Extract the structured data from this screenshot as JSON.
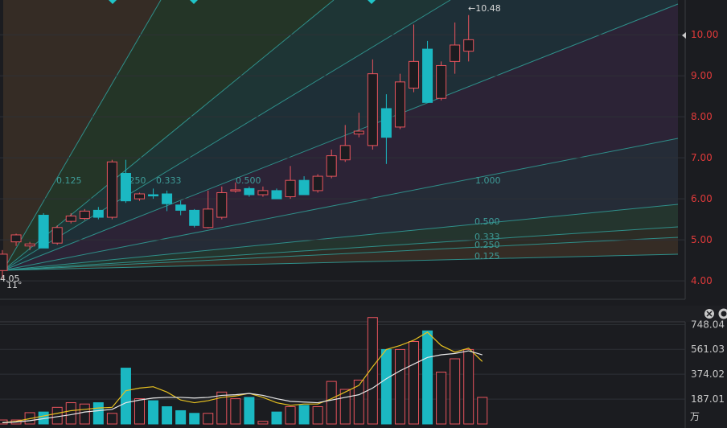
{
  "chart_data": [
    {
      "type": "candlestick",
      "title": "",
      "y_axis": {
        "ticks": [
          "10.00",
          "9.00",
          "8.00",
          "7.00",
          "6.00",
          "5.00",
          "4.00"
        ],
        "ylim": [
          3.55,
          10.75
        ]
      },
      "high_label": "10.48",
      "low_label": "4.05",
      "angle_label": "11°",
      "gann_fan_levels_upper": [
        "0.125",
        "0.250",
        "0.333",
        "0.500",
        "1.000"
      ],
      "gann_fan_levels_lower": [
        "0.500",
        "0.333",
        "0.250",
        "0.125"
      ],
      "candles": [
        {
          "o": 4.25,
          "h": 4.75,
          "l": 4.05,
          "c": 4.65
        },
        {
          "o": 4.95,
          "h": 5.15,
          "l": 4.85,
          "c": 5.12
        },
        {
          "o": 4.85,
          "h": 4.95,
          "l": 4.75,
          "c": 4.9
        },
        {
          "o": 5.6,
          "h": 5.65,
          "l": 4.8,
          "c": 4.8
        },
        {
          "o": 4.92,
          "h": 5.35,
          "l": 4.88,
          "c": 5.3
        },
        {
          "o": 5.45,
          "h": 5.65,
          "l": 5.4,
          "c": 5.58
        },
        {
          "o": 5.52,
          "h": 5.75,
          "l": 5.48,
          "c": 5.7
        },
        {
          "o": 5.72,
          "h": 5.8,
          "l": 5.5,
          "c": 5.55
        },
        {
          "o": 5.55,
          "h": 6.95,
          "l": 5.5,
          "c": 6.9
        },
        {
          "o": 6.62,
          "h": 6.95,
          "l": 5.9,
          "c": 5.95
        },
        {
          "o": 6.0,
          "h": 6.15,
          "l": 5.95,
          "c": 6.12
        },
        {
          "o": 6.1,
          "h": 6.25,
          "l": 6.0,
          "c": 6.08
        },
        {
          "o": 6.12,
          "h": 6.2,
          "l": 5.7,
          "c": 5.88
        },
        {
          "o": 5.85,
          "h": 5.95,
          "l": 5.6,
          "c": 5.72
        },
        {
          "o": 5.72,
          "h": 5.75,
          "l": 5.3,
          "c": 5.35
        },
        {
          "o": 5.3,
          "h": 6.2,
          "l": 5.28,
          "c": 5.75
        },
        {
          "o": 5.55,
          "h": 6.3,
          "l": 5.5,
          "c": 6.15
        },
        {
          "o": 6.2,
          "h": 6.4,
          "l": 6.15,
          "c": 6.22
        },
        {
          "o": 6.25,
          "h": 6.3,
          "l": 6.05,
          "c": 6.1
        },
        {
          "o": 6.1,
          "h": 6.3,
          "l": 6.05,
          "c": 6.2
        },
        {
          "o": 6.2,
          "h": 6.25,
          "l": 6.0,
          "c": 6.0
        },
        {
          "o": 6.05,
          "h": 6.8,
          "l": 6.0,
          "c": 6.45
        },
        {
          "o": 6.45,
          "h": 6.55,
          "l": 6.1,
          "c": 6.1
        },
        {
          "o": 6.2,
          "h": 6.6,
          "l": 6.15,
          "c": 6.55
        },
        {
          "o": 6.55,
          "h": 7.2,
          "l": 6.5,
          "c": 7.05
        },
        {
          "o": 6.95,
          "h": 7.8,
          "l": 6.9,
          "c": 7.3
        },
        {
          "o": 7.58,
          "h": 8.1,
          "l": 7.5,
          "c": 7.65
        },
        {
          "o": 7.3,
          "h": 9.4,
          "l": 7.2,
          "c": 9.05
        },
        {
          "o": 8.2,
          "h": 8.55,
          "l": 6.85,
          "c": 7.5
        },
        {
          "o": 7.75,
          "h": 9.05,
          "l": 7.7,
          "c": 8.85
        },
        {
          "o": 8.7,
          "h": 10.25,
          "l": 8.6,
          "c": 9.35
        },
        {
          "o": 9.65,
          "h": 9.85,
          "l": 8.35,
          "c": 8.35
        },
        {
          "o": 8.45,
          "h": 9.35,
          "l": 8.4,
          "c": 9.25
        },
        {
          "o": 9.35,
          "h": 10.3,
          "l": 9.05,
          "c": 9.75
        },
        {
          "o": 9.6,
          "h": 10.48,
          "l": 9.35,
          "c": 9.88
        }
      ]
    },
    {
      "type": "bar",
      "y_axis": {
        "ticks": [
          "748.04",
          "561.03",
          "374.02",
          "187.01"
        ],
        "unit": "万",
        "ylim": [
          0,
          750
        ]
      },
      "values": [
        30,
        30,
        85,
        90,
        125,
        160,
        150,
        160,
        80,
        420,
        190,
        175,
        130,
        100,
        80,
        80,
        240,
        190,
        200,
        20,
        90,
        130,
        140,
        130,
        320,
        260,
        330,
        800,
        560,
        560,
        620,
        700,
        390,
        490,
        560,
        200
      ],
      "ma_short": [
        10,
        20,
        40,
        60,
        80,
        100,
        110,
        120,
        125,
        250,
        270,
        280,
        240,
        180,
        160,
        175,
        200,
        210,
        230,
        200,
        160,
        140,
        150,
        150,
        190,
        240,
        290,
        430,
        560,
        590,
        630,
        690,
        590,
        540,
        570,
        470
      ],
      "ma_long": [
        10,
        15,
        25,
        40,
        55,
        70,
        90,
        100,
        110,
        160,
        180,
        195,
        200,
        200,
        195,
        200,
        215,
        220,
        230,
        215,
        190,
        170,
        165,
        160,
        180,
        200,
        220,
        270,
        340,
        400,
        450,
        500,
        520,
        530,
        550,
        520
      ]
    }
  ]
}
